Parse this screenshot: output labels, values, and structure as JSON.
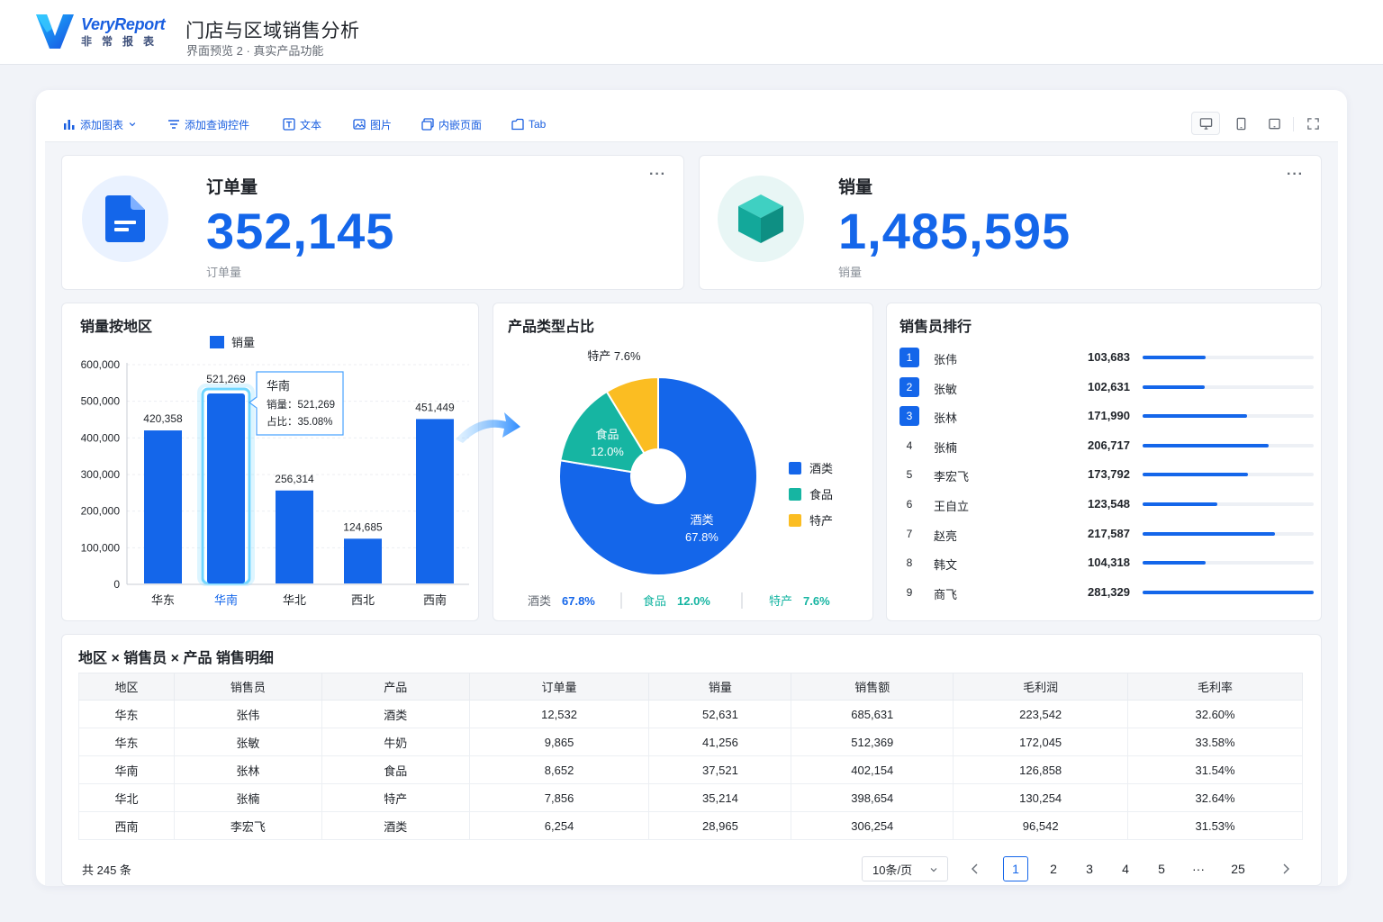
{
  "header": {
    "logo_en": "VeryReport",
    "logo_cn": "非常报表",
    "title": "门店与区域销售分析",
    "subtitle": "界面预览 2 · 真实产品功能"
  },
  "toolbar": {
    "items": [
      {
        "label": "添加图表",
        "icon": "bar-chart-icon"
      },
      {
        "label": "添加查询控件",
        "icon": "filter-icon"
      },
      {
        "label": "文本",
        "icon": "text-icon"
      },
      {
        "label": "图片",
        "icon": "image-icon"
      },
      {
        "label": "内嵌页面",
        "icon": "embed-icon"
      },
      {
        "label": "Tab",
        "icon": "tab-icon"
      }
    ],
    "right_icons": [
      "desktop-icon",
      "tablet-icon",
      "tablet-landscape-icon",
      "fullscreen-icon"
    ]
  },
  "kpi": [
    {
      "label": "订单量",
      "value": "352,145",
      "sub": "订单量",
      "more": "···",
      "icon": "document-icon"
    },
    {
      "label": "销量",
      "value": "1,485,595",
      "sub": "销量",
      "more": "···",
      "icon": "cube-icon"
    }
  ],
  "bar_card": {
    "title": "销量按地区",
    "chart_data": {
      "type": "bar",
      "categories": [
        "华东",
        "华南",
        "华北",
        "西北",
        "西南"
      ],
      "series": [
        {
          "name": "销量",
          "values": [
            420358,
            521269,
            256314,
            124685,
            451449
          ]
        }
      ],
      "value_labels": [
        "420,358",
        "521,269",
        "256,314",
        "124,685",
        "451,449"
      ],
      "ylim": [
        0,
        600000
      ],
      "yticks": [
        "0",
        "100,000",
        "200,000",
        "300,000",
        "400,000",
        "500,000",
        "600,000"
      ],
      "legend": "top",
      "highlight_index": 1,
      "tooltip": {
        "title": "华南",
        "line1": "销量：521,269",
        "line2": "占比：35.08%"
      },
      "colors": {
        "bar": "#1466ea",
        "highlight": "#1466ea"
      }
    }
  },
  "pie_card": {
    "title": "产品类型占比",
    "chart_data": {
      "type": "pie",
      "categories": [
        "酒类",
        "食品",
        "特产"
      ],
      "values": [
        67.8,
        12.0,
        7.6
      ],
      "slice_labels": [
        "67.8%",
        "12.0%",
        "7.6%"
      ],
      "colors": [
        "#1466ea",
        "#16b5a2",
        "#fbbd22"
      ],
      "legend": "right"
    },
    "footer": [
      {
        "name": "酒类",
        "value": "67.8%",
        "color": "#1466ea"
      },
      {
        "name": "食品",
        "value": "12.0%",
        "color": "#16b5a2"
      },
      {
        "name": "特产",
        "value": "7.6%",
        "color": "#16b5a2"
      }
    ]
  },
  "rank_card": {
    "title": "销售员排行",
    "max": 281329,
    "rows": [
      {
        "rank": "1",
        "name": "张伟",
        "value": "103,683",
        "num": 103683
      },
      {
        "rank": "2",
        "name": "张敏",
        "value": "102,631",
        "num": 102631
      },
      {
        "rank": "3",
        "name": "张林",
        "value": "171,990",
        "num": 171990
      },
      {
        "rank": "4",
        "name": "张楠",
        "value": "206,717",
        "num": 206717
      },
      {
        "rank": "5",
        "name": "李宏飞",
        "value": "173,792",
        "num": 173792
      },
      {
        "rank": "6",
        "name": "王自立",
        "value": "123,548",
        "num": 123548
      },
      {
        "rank": "7",
        "name": "赵亮",
        "value": "217,587",
        "num": 217587
      },
      {
        "rank": "8",
        "name": "韩文",
        "value": "104,318",
        "num": 104318
      },
      {
        "rank": "9",
        "name": "商飞",
        "value": "281,329",
        "num": 281329
      }
    ]
  },
  "table_card": {
    "title": "地区 × 销售员 × 产品 销售明细",
    "columns": [
      "地区",
      "销售员",
      "产品",
      "订单量",
      "销量",
      "销售额",
      "毛利润",
      "毛利率"
    ],
    "rows": [
      [
        "华东",
        "张伟",
        "酒类",
        "12,532",
        "52,631",
        "685,631",
        "223,542",
        "32.60%"
      ],
      [
        "华东",
        "张敏",
        "牛奶",
        "9,865",
        "41,256",
        "512,369",
        "172,045",
        "33.58%"
      ],
      [
        "华南",
        "张林",
        "食品",
        "8,652",
        "37,521",
        "402,154",
        "126,858",
        "31.54%"
      ],
      [
        "华北",
        "张楠",
        "特产",
        "7,856",
        "35,214",
        "398,654",
        "130,254",
        "32.64%"
      ],
      [
        "西南",
        "李宏飞",
        "酒类",
        "6,254",
        "28,965",
        "306,254",
        "96,542",
        "31.53%"
      ]
    ],
    "total": "共 245 条",
    "page_size": "10条/页",
    "pages": [
      "1",
      "2",
      "3",
      "4",
      "5",
      "···",
      "25"
    ],
    "current_page": "1"
  }
}
